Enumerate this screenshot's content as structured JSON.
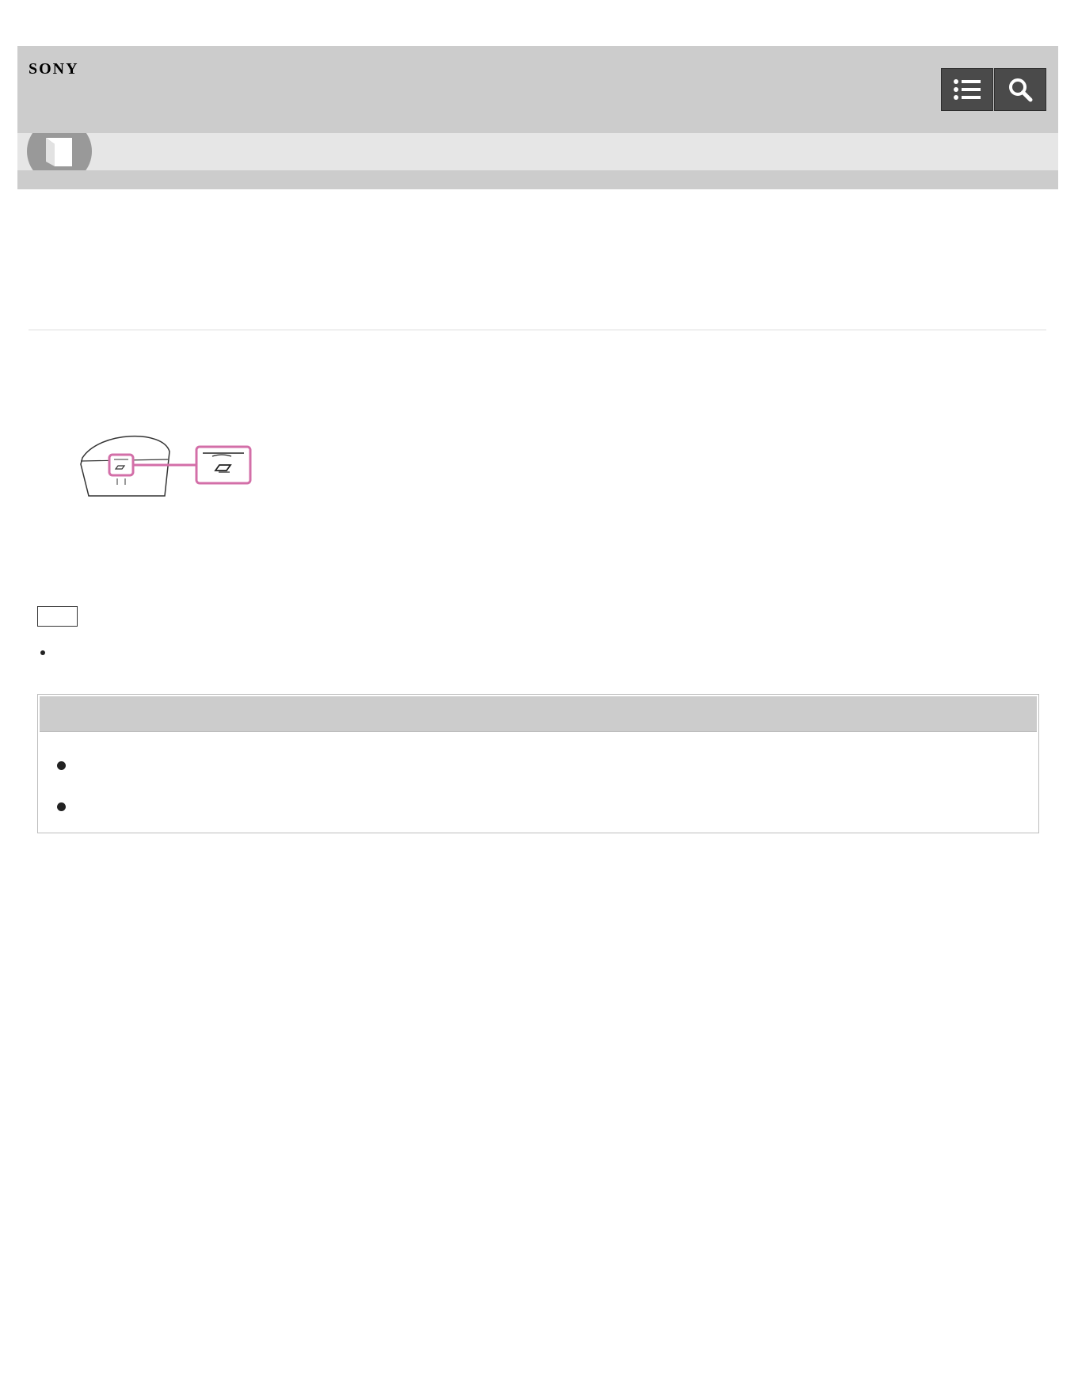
{
  "header": {
    "brand": "SONY",
    "toc_button_icon": "list-icon",
    "search_button_icon": "search-icon"
  },
  "subbar": {
    "icon": "book-icon"
  },
  "content": {
    "illustration": "charging-case-battery-indicator",
    "note_label": "",
    "note_items": [
      ""
    ],
    "related_heading": "",
    "related_items": [
      "",
      ""
    ]
  },
  "colors": {
    "header_bg": "#cccccc",
    "subbar_bg": "#e6e6e6",
    "button_bg": "#4a4a4a",
    "highlight": "#d36fa8"
  }
}
